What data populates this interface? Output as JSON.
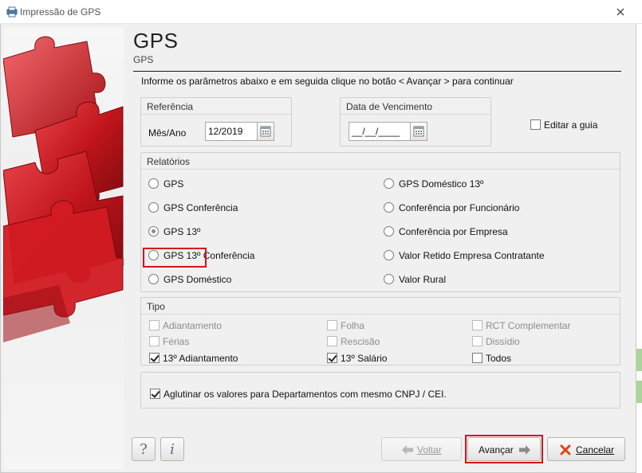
{
  "window": {
    "title": "Impressão de GPS"
  },
  "header": {
    "title": "GPS",
    "subtitle": "GPS",
    "instruction": "Informe os parâmetros abaixo e em seguida clique no botão < Avançar > para continuar"
  },
  "referencia": {
    "group_title": "Referência",
    "label": "Mês/Ano",
    "value": "12/2019"
  },
  "vencimento": {
    "group_title": "Data de Vencimento",
    "value": "__/__/____"
  },
  "editar_guia": {
    "label": "Editar a guia",
    "checked": false
  },
  "relatorios": {
    "group_title": "Relatórios",
    "left": [
      "GPS",
      "GPS Conferência",
      "GPS 13º",
      "GPS 13º Conferência",
      "GPS Doméstico"
    ],
    "right": [
      "GPS Doméstico 13º",
      "Conferência por Funcionário",
      "Conferência por Empresa",
      "Valor Retido Empresa Contratante",
      "Valor Rural"
    ],
    "selected": "GPS 13º"
  },
  "tipo": {
    "group_title": "Tipo",
    "items": [
      {
        "label": "Adiantamento",
        "checked": false,
        "enabled": false
      },
      {
        "label": "Folha",
        "checked": false,
        "enabled": false
      },
      {
        "label": "RCT Complementar",
        "checked": false,
        "enabled": false
      },
      {
        "label": "Férias",
        "checked": false,
        "enabled": false
      },
      {
        "label": "Rescisão",
        "checked": false,
        "enabled": false
      },
      {
        "label": "Dissídio",
        "checked": false,
        "enabled": false
      },
      {
        "label": "13º Adiantamento",
        "checked": true,
        "enabled": true
      },
      {
        "label": "13º Salário",
        "checked": true,
        "enabled": true
      },
      {
        "label": "Todos",
        "checked": false,
        "enabled": true
      }
    ]
  },
  "aglutinar": {
    "label": "Aglutinar os valores para Departamentos com mesmo CNPJ / CEI.",
    "checked": true
  },
  "footer": {
    "help_label": "?",
    "info_label": "i",
    "voltar_label": "Voltar",
    "avancar_label": "Avançar",
    "cancelar_label": "Cancelar"
  },
  "colors": {
    "highlight": "#d4161c",
    "puzzle_red": "#c0151b"
  }
}
